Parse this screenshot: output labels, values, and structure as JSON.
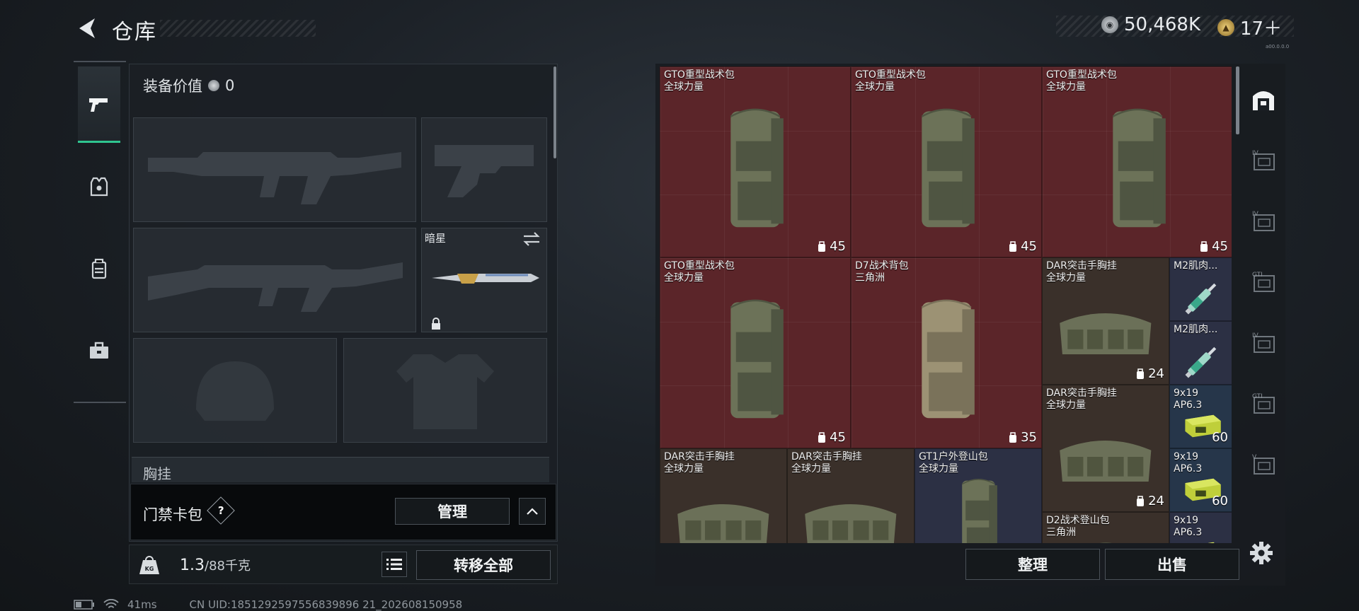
{
  "header": {
    "title": "仓库",
    "money": "50,468K",
    "bonds": "17＋",
    "build": "a00.0.0.0"
  },
  "left_tabs": [
    {
      "name": "weapons-tab"
    },
    {
      "name": "armor-tab"
    },
    {
      "name": "backpack-tab"
    },
    {
      "name": "toolbox-tab"
    }
  ],
  "loadout": {
    "equipment_value_label": "装备价值",
    "equipment_value": "0",
    "melee_slot_label": "暗星",
    "chest_rig_label": "胸挂",
    "keycard_label": "门禁卡包",
    "help": "?",
    "manage_button": "管理",
    "weight_current": "1.3",
    "weight_max": "/88千克",
    "transfer_all_button": "转移全部"
  },
  "status": {
    "ping": "41ms",
    "uid": "CN UID:1851292597556839896 21_202608150958"
  },
  "storage": {
    "items": [
      {
        "name": "GTO重型战术包",
        "tag": "全球力量",
        "count": "45",
        "icon": "backpack-icon"
      },
      {
        "name": "GTO重型战术包",
        "tag": "全球力量",
        "count": "45",
        "icon": "backpack-icon"
      },
      {
        "name": "GTO重型战术包",
        "tag": "全球力量",
        "count": "45",
        "icon": "backpack-icon"
      },
      {
        "name": "GTO重型战术包",
        "tag": "全球力量",
        "count": "45",
        "icon": "backpack-icon"
      },
      {
        "name": "D7战术背包",
        "tag": "三角洲",
        "count": "35",
        "icon": "backpack-icon"
      },
      {
        "name": "DAR突击手胸挂",
        "tag": "全球力量",
        "count": "24",
        "icon": "chest-rig-icon"
      },
      {
        "name": "M2肌肉...",
        "tag": "",
        "count": "",
        "icon": "syringe-icon"
      },
      {
        "name": "M2肌肉...",
        "tag": "",
        "count": "",
        "icon": "syringe-icon"
      },
      {
        "name": "DAR突击手胸挂",
        "tag": "全球力量",
        "count": "24",
        "icon": "chest-rig-icon"
      },
      {
        "name": "9x19",
        "tag": "AP6.3",
        "count": "60",
        "icon": "ammo-box-icon"
      },
      {
        "name": "9x19",
        "tag": "AP6.3",
        "count": "60",
        "icon": "ammo-box-icon"
      },
      {
        "name": "DAR突击手胸挂",
        "tag": "全球力量",
        "count": "",
        "icon": "chest-rig-icon"
      },
      {
        "name": "DAR突击手胸挂",
        "tag": "全球力量",
        "count": "",
        "icon": "chest-rig-icon"
      },
      {
        "name": "GT1户外登山包",
        "tag": "全球力量",
        "count": "",
        "icon": "backpack-icon"
      },
      {
        "name": "D2战术登山包",
        "tag": "三角洲",
        "count": "",
        "icon": "backpack-icon"
      },
      {
        "name": "9x19",
        "tag": "AP6.3",
        "count": "",
        "icon": "ammo-box-icon"
      }
    ],
    "sort_button": "整理",
    "sell_button": "出售"
  },
  "right_tabs": [
    {
      "name": "storage-all-tab"
    },
    {
      "name": "storage-tab-1",
      "label": "IV"
    },
    {
      "name": "storage-tab-2",
      "label": "IV"
    },
    {
      "name": "storage-tab-3",
      "label": "GTI"
    },
    {
      "name": "storage-tab-4",
      "label": "IV"
    },
    {
      "name": "storage-tab-5",
      "label": "GTI"
    },
    {
      "name": "storage-tab-6",
      "label": "V"
    }
  ],
  "colors": {
    "accent": "#2fc58f",
    "danger_cell": "#5b2529",
    "panel": "#1b2025"
  }
}
